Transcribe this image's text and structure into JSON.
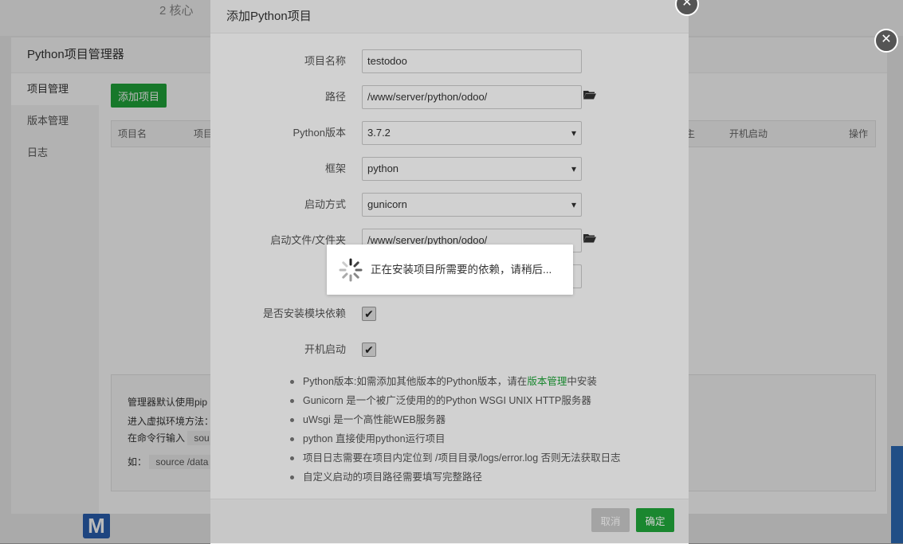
{
  "background": {
    "core_label": "2 核心",
    "logo_letter": "M"
  },
  "outer_dialog": {
    "title": "Python项目管理器",
    "sidebar": [
      {
        "label": "项目管理"
      },
      {
        "label": "版本管理"
      },
      {
        "label": "日志"
      }
    ],
    "add_button": "添加项目",
    "table_headers": {
      "name": "项目名",
      "col2": "项目",
      "col3": "主",
      "autostart": "开机启动",
      "actions": "操作"
    },
    "info_lines": {
      "line1": "管理器默认使用pip",
      "line2": "进入虚拟环境方法：",
      "line3": "在命令行输入",
      "line3_code": "sou",
      "line4": "如：",
      "line4_code": "source /data"
    }
  },
  "dialog": {
    "title": "添加Python项目",
    "fields": {
      "name": {
        "label": "项目名称",
        "value": "testodoo"
      },
      "path": {
        "label": "路径",
        "value": "/www/server/python/odoo/"
      },
      "version": {
        "label": "Python版本",
        "value": "3.7.2"
      },
      "framework": {
        "label": "框架",
        "value": "python"
      },
      "startup": {
        "label": "启动方式",
        "value": "gunicorn"
      },
      "startfile": {
        "label": "启动文件/文件夹",
        "value": "/www/server/python/odoo/"
      },
      "install_deps": {
        "label": "是否安装模块依赖",
        "checked": true
      },
      "autostart": {
        "label": "开机启动",
        "checked": true
      }
    },
    "tips": {
      "t1_pre": "Python版本:如需添加其他版本的Python版本，请在",
      "t1_link": "版本管理",
      "t1_post": "中安装",
      "t2": "Gunicorn 是一个被广泛使用的的Python WSGI UNIX HTTP服务器",
      "t3": "uWsgi 是一个高性能WEB服务器",
      "t4": "python 直接使用python运行项目",
      "t5": "项目日志需要在项目内定位到 /项目目录/logs/error.log 否则无法获取日志",
      "t6": "自定义启动的项目路径需要填写完整路径"
    },
    "cancel": "取消",
    "confirm": "确定"
  },
  "loading": {
    "message": "正在安装项目所需要的依赖，请稍后..."
  },
  "colors": {
    "accent": "#20a53a",
    "link": "#20a53a",
    "cancel": "#c9c9c9"
  }
}
